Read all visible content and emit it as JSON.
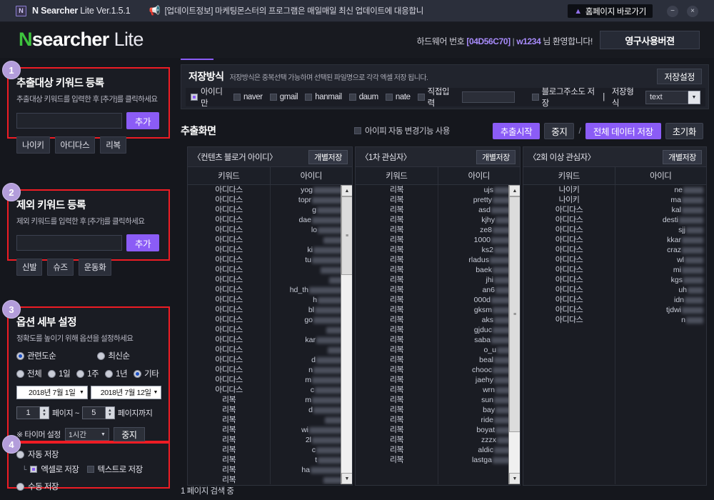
{
  "titlebar": {
    "logo_text": "N",
    "app_name_bold": "N Searcher",
    "app_name_thin": " Lite Ver.1.5.1",
    "notice_icon": "megaphone-icon",
    "notice_text": "[업데이트정보] 마케팅몬스터의 프로그램은 매일매일 최신 업데이트에 대응합니",
    "home_icon": "home-icon",
    "home_label": "홈페이지 바로가기",
    "minimize_label": "−",
    "close_label": "×"
  },
  "header": {
    "brand_n": "N",
    "brand_searcher": "searcher",
    "brand_lite": "Lite",
    "hw_label": "하드웨어 번호",
    "hw_code": "[04D56C70]",
    "hw_sep": "|",
    "hw_user": "w1234",
    "hw_welcome": "님 환영합니다!",
    "version_button": "영구사용버젼"
  },
  "sidebar": {
    "sections": [
      {
        "badge": "1",
        "title": "추출대상 키워드 등록",
        "subtitle": "추출대상 키워드를 입력한 후 [추가]를 클릭하세요",
        "input_value": "",
        "input_placeholder": "",
        "add_button": "추가",
        "chips": [
          "나이키",
          "아디다스",
          "리복"
        ]
      },
      {
        "badge": "2",
        "title": "제외 키워드 등록",
        "subtitle": "제외 키워드를 입력한 후 [추가]를 클릭하세요",
        "input_value": "",
        "input_placeholder": "",
        "add_button": "추가",
        "chips": [
          "신발",
          "슈즈",
          "운동화"
        ]
      }
    ],
    "options": {
      "badge": "3",
      "title": "옵션 세부 설정",
      "subtitle": "정확도를 높이기 위해 옵션을 설정하세요",
      "sort_options": [
        {
          "label": "관련도순",
          "selected": true
        },
        {
          "label": "최신순",
          "selected": false
        }
      ],
      "period_options": [
        {
          "label": "전체",
          "selected": false
        },
        {
          "label": "1일",
          "selected": false
        },
        {
          "label": "1주",
          "selected": false
        },
        {
          "label": "1년",
          "selected": false
        },
        {
          "label": "기타",
          "selected": true
        }
      ],
      "date_from": "2018년  7월  1일",
      "date_to": "2018년  7월 12일",
      "page_from": "1",
      "page_mid_label": "페이지 ~",
      "page_to": "5",
      "page_end_label": "페이지까지",
      "timer_label": "※ 타이머 설정",
      "timer_value": "1시간",
      "timer_stop_button": "중지"
    },
    "save": {
      "badge": "4",
      "auto_label": "자동 저장",
      "auto_selected": false,
      "excel_label": "엑셀로 저장",
      "excel_checked": true,
      "text_label": "텍스트로 저장",
      "text_checked": false,
      "manual_label": "수동 저장",
      "manual_selected": false
    }
  },
  "save_method": {
    "title": "저장방식",
    "subtitle": "저장방식은 중복선택 가능하며 선택된 파일명으로 각각 엑셀 저장 됩니다.",
    "settings_button": "저장설정",
    "options": [
      {
        "label": "아이디만",
        "checked": true
      },
      {
        "label": "naver",
        "checked": false
      },
      {
        "label": "gmail",
        "checked": false
      },
      {
        "label": "hanmail",
        "checked": false
      },
      {
        "label": "daum",
        "checked": false
      },
      {
        "label": "nate",
        "checked": false
      },
      {
        "label": "직접입력",
        "checked": false
      }
    ],
    "direct_input_value": "",
    "blog_url_label": "블로그주소도 저장",
    "blog_url_checked": false,
    "divider": "|",
    "format_label": "저장형식",
    "format_value": "text"
  },
  "extract": {
    "title": "추출화면",
    "ip_auto_label": "아이피 자동 변경기능 사용",
    "ip_auto_checked": false,
    "start_button": "추출시작",
    "stop_button": "중지",
    "separator": "/",
    "save_all_button": "전체 데이터 저장",
    "reset_button": "초기화"
  },
  "tables": [
    {
      "title": "〈컨텐츠 블로거 아이디〉",
      "save_button": "개별저장",
      "columns": [
        "키워드",
        "아이디"
      ],
      "rows": [
        {
          "kw": "아디다스",
          "id_prefix": "yog",
          "blur": 50
        },
        {
          "kw": "아디다스",
          "id_prefix": "topr",
          "blur": 52
        },
        {
          "kw": "아디다스",
          "id_prefix": "g",
          "blur": 45
        },
        {
          "kw": "아디다스",
          "id_prefix": "dae",
          "blur": 52
        },
        {
          "kw": "아디다스",
          "id_prefix": "lo",
          "blur": 44
        },
        {
          "kw": "아디다스",
          "id_prefix": "",
          "blur": 36
        },
        {
          "kw": "아디다스",
          "id_prefix": "ki",
          "blur": 50
        },
        {
          "kw": "아디다스",
          "id_prefix": "tu",
          "blur": 52
        },
        {
          "kw": "아디다스",
          "id_prefix": "",
          "blur": 40
        },
        {
          "kw": "아디다스",
          "id_prefix": "",
          "blur": 28
        },
        {
          "kw": "아디다스",
          "id_prefix": "hd_th",
          "blur": 56
        },
        {
          "kw": "아디다스",
          "id_prefix": "h",
          "blur": 44
        },
        {
          "kw": "아디다스",
          "id_prefix": "bl",
          "blur": 48
        },
        {
          "kw": "아디다스",
          "id_prefix": "go",
          "blur": 50
        },
        {
          "kw": "아디다스",
          "id_prefix": "",
          "blur": 32
        },
        {
          "kw": "아디다스",
          "id_prefix": "kar",
          "blur": 46
        },
        {
          "kw": "아디다스",
          "id_prefix": "",
          "blur": 30
        },
        {
          "kw": "아디다스",
          "id_prefix": "d",
          "blur": 46
        },
        {
          "kw": "아디다스",
          "id_prefix": "n",
          "blur": 50
        },
        {
          "kw": "아디다스",
          "id_prefix": "m",
          "blur": 52
        },
        {
          "kw": "아디다스",
          "id_prefix": "c",
          "blur": 48
        },
        {
          "kw": "리복",
          "id_prefix": "m",
          "blur": 52
        },
        {
          "kw": "리복",
          "id_prefix": "d",
          "blur": 50
        },
        {
          "kw": "리복",
          "id_prefix": "",
          "blur": 34
        },
        {
          "kw": "리복",
          "id_prefix": "wi",
          "blur": 56
        },
        {
          "kw": "리복",
          "id_prefix": "2l",
          "blur": 52
        },
        {
          "kw": "리복",
          "id_prefix": "c",
          "blur": 46
        },
        {
          "kw": "리복",
          "id_prefix": "t",
          "blur": 44
        },
        {
          "kw": "리복",
          "id_prefix": "ha",
          "blur": 54
        },
        {
          "kw": "리복",
          "id_prefix": "",
          "blur": 36
        }
      ],
      "scroll_position": "top"
    },
    {
      "title": "〈1차 관심자〉",
      "save_button": "개별저장",
      "columns": [
        "키워드",
        "아이디"
      ],
      "rows": [
        {
          "kw": "리복",
          "id_prefix": "ujs",
          "blur": 32
        },
        {
          "kw": "리복",
          "id_prefix": "pretty",
          "blur": 34
        },
        {
          "kw": "리복",
          "id_prefix": "asd",
          "blur": 36
        },
        {
          "kw": "리복",
          "id_prefix": "kjhy",
          "blur": 30
        },
        {
          "kw": "리복",
          "id_prefix": "ze8",
          "blur": 34
        },
        {
          "kw": "리복",
          "id_prefix": "1000",
          "blur": 36
        },
        {
          "kw": "리복",
          "id_prefix": "ks2",
          "blur": 32
        },
        {
          "kw": "리복",
          "id_prefix": "rladus",
          "blur": 38
        },
        {
          "kw": "리복",
          "id_prefix": "baek",
          "blur": 34
        },
        {
          "kw": "리복",
          "id_prefix": "jhi",
          "blur": 32
        },
        {
          "kw": "리복",
          "id_prefix": "an6",
          "blur": 30
        },
        {
          "kw": "리복",
          "id_prefix": "000d",
          "blur": 36
        },
        {
          "kw": "리복",
          "id_prefix": "gksm",
          "blur": 34
        },
        {
          "kw": "리복",
          "id_prefix": "aks",
          "blur": 32
        },
        {
          "kw": "리복",
          "id_prefix": "gjduc",
          "blur": 34
        },
        {
          "kw": "리복",
          "id_prefix": "saba",
          "blur": 36
        },
        {
          "kw": "리복",
          "id_prefix": "o_u",
          "blur": 28
        },
        {
          "kw": "리복",
          "id_prefix": "beal",
          "blur": 32
        },
        {
          "kw": "리복",
          "id_prefix": "chooc",
          "blur": 34
        },
        {
          "kw": "리복",
          "id_prefix": "jaehy",
          "blur": 32
        },
        {
          "kw": "리복",
          "id_prefix": "wrn",
          "blur": 30
        },
        {
          "kw": "리복",
          "id_prefix": "sun",
          "blur": 32
        },
        {
          "kw": "리복",
          "id_prefix": "bay",
          "blur": 30
        },
        {
          "kw": "리복",
          "id_prefix": "ride",
          "blur": 32
        },
        {
          "kw": "리복",
          "id_prefix": "boyat",
          "blur": 30
        },
        {
          "kw": "리복",
          "id_prefix": "zzzx",
          "blur": 28
        },
        {
          "kw": "리복",
          "id_prefix": "aldic",
          "blur": 32
        },
        {
          "kw": "리복",
          "id_prefix": "lastga",
          "blur": 34
        }
      ],
      "scroll_position": "top"
    },
    {
      "title": "〈2회 이상 관심자〉",
      "save_button": "개별저장",
      "columns": [
        "키워드",
        "아이디"
      ],
      "rows": [
        {
          "kw": "나이키",
          "id_prefix": "ne",
          "blur": 28
        },
        {
          "kw": "나이키",
          "id_prefix": "ma",
          "blur": 30
        },
        {
          "kw": "아디다스",
          "id_prefix": "kal",
          "blur": 30
        },
        {
          "kw": "아디다스",
          "id_prefix": "desti",
          "blur": 34
        },
        {
          "kw": "아디다스",
          "id_prefix": "sjj",
          "blur": 24
        },
        {
          "kw": "아디다스",
          "id_prefix": "kkar",
          "blur": 30
        },
        {
          "kw": "아디다스",
          "id_prefix": "craz",
          "blur": 30
        },
        {
          "kw": "아디다스",
          "id_prefix": "wl",
          "blur": 26
        },
        {
          "kw": "아디다스",
          "id_prefix": "mi",
          "blur": 30
        },
        {
          "kw": "아디다스",
          "id_prefix": "kgs",
          "blur": 28
        },
        {
          "kw": "아디다스",
          "id_prefix": "uh",
          "blur": 22
        },
        {
          "kw": "아디다스",
          "id_prefix": "idn",
          "blur": 26
        },
        {
          "kw": "아디다스",
          "id_prefix": "tjdwi",
          "blur": 30
        },
        {
          "kw": "아디다스",
          "id_prefix": "n",
          "blur": 24
        }
      ],
      "scroll_position": "none"
    }
  ],
  "statusbar": {
    "text": "1 페이지 검색 중"
  }
}
